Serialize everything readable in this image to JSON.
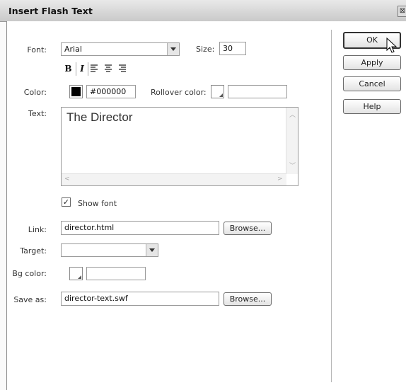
{
  "dialog": {
    "title": "Insert Flash Text",
    "close_glyph": "⊠"
  },
  "form": {
    "font_label": "Font:",
    "font_value": "Arial",
    "size_label": "Size:",
    "size_value": "30",
    "format_bold": "B",
    "format_italic": "I",
    "color_label": "Color:",
    "color_value": "#000000",
    "color_swatch": "#000000",
    "rollover_label": "Rollover color:",
    "rollover_value": "",
    "text_label": "Text:",
    "text_value": "The Director",
    "show_font_label": "Show font",
    "show_font_checked": "✓",
    "link_label": "Link:",
    "link_value": "director.html",
    "browse_label": "Browse...",
    "target_label": "Target:",
    "target_value": "",
    "bg_label": "Bg color:",
    "bg_value": "",
    "save_label": "Save as:",
    "save_value": "director-text.swf"
  },
  "buttons": {
    "ok": "OK",
    "apply": "Apply",
    "cancel": "Cancel",
    "help": "Help"
  },
  "icons": {
    "dropdown": "chevron-down-icon",
    "close": "close-icon",
    "cursor": "mouse-pointer-icon",
    "align_left": "align-left-icon",
    "align_center": "align-center-icon",
    "align_right": "align-right-icon"
  }
}
